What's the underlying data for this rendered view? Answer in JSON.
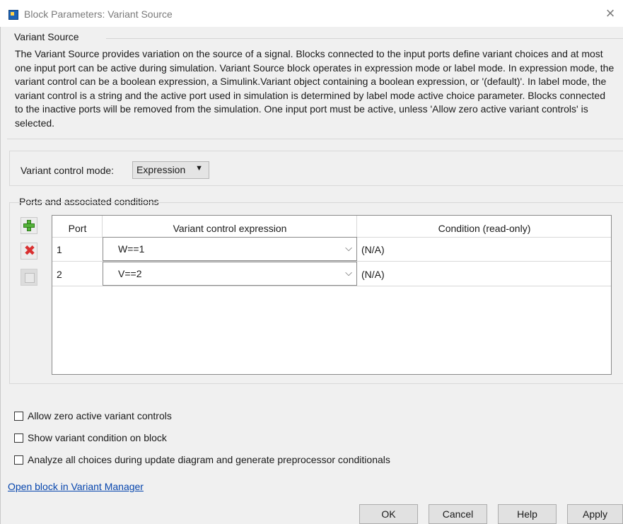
{
  "window": {
    "title": "Block Parameters: Variant Source",
    "close_glyph": "×",
    "icon": "simulink-block-icon"
  },
  "block": {
    "name": "Variant Source",
    "description": "The Variant Source provides variation on the source of a signal. Blocks connected to the input ports define variant choices and at most one input port can be active during simulation. Variant Source block operates in expression mode or label mode. In expression mode, the variant control can be a boolean expression, a Simulink.Variant object containing a boolean expression, or '(default)'. In label mode, the variant control is a string and the active port used in simulation is determined by label mode active choice parameter. Blocks connected to the inactive ports will be removed from the simulation. One input port must be active, unless 'Allow zero active variant controls' is selected."
  },
  "mode": {
    "label": "Variant control mode:",
    "selected": "Expression",
    "arrow": "▼"
  },
  "ports": {
    "section_title": "Ports and associated conditions",
    "headers": {
      "port": "Port",
      "expression": "Variant control expression",
      "condition": "Condition (read-only)"
    },
    "rows": [
      {
        "port": "1",
        "expression": "W==1",
        "condition": "(N/A)"
      },
      {
        "port": "2",
        "expression": "V==2",
        "condition": "(N/A)"
      }
    ],
    "buttons": {
      "add_icon": "plus-icon",
      "delete_icon": "delete-x-icon",
      "edit_icon": "edit-icon"
    }
  },
  "options": [
    {
      "label": "Allow zero active variant controls",
      "checked": false
    },
    {
      "label": "Show variant condition on block",
      "checked": false
    },
    {
      "label": "Analyze all choices during update diagram and generate preprocessor conditionals",
      "checked": false
    }
  ],
  "link": {
    "label": "Open block in Variant Manager"
  },
  "footer": {
    "ok": "OK",
    "cancel": "Cancel",
    "help": "Help",
    "apply": "Apply"
  },
  "colors": {
    "background": "#f0f0f0",
    "link": "#0645ad",
    "add_green": "#55b33a",
    "delete_red": "#d93030"
  }
}
